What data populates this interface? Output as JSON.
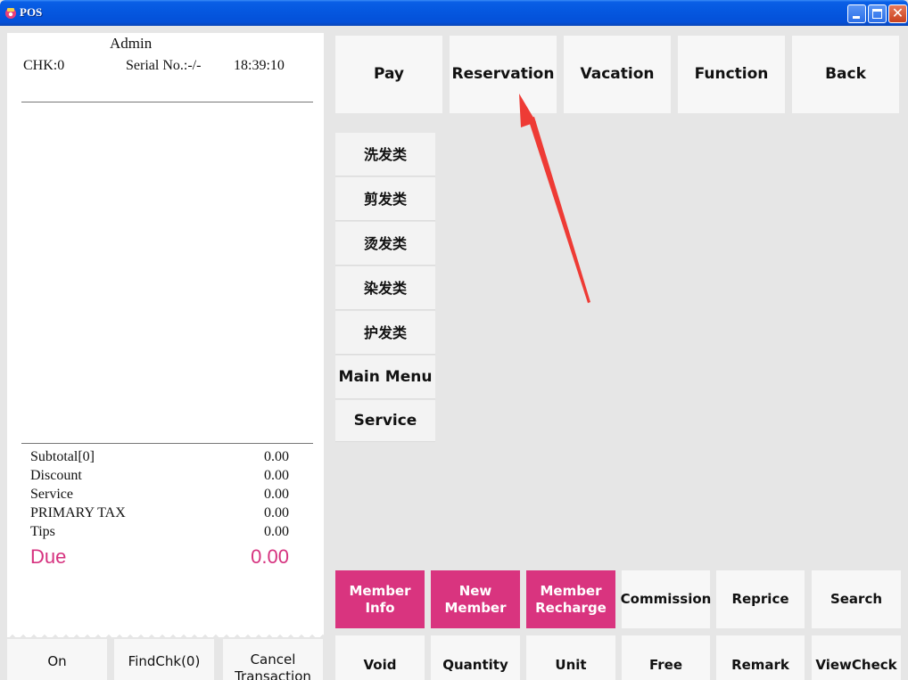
{
  "window": {
    "title": "POS"
  },
  "receipt": {
    "operator": "Admin",
    "check": "CHK:0",
    "serial": "Serial No.:-/-",
    "time": "18:39:10",
    "totals": [
      {
        "label": "Subtotal[0]",
        "value": "0.00"
      },
      {
        "label": "Discount",
        "value": "0.00"
      },
      {
        "label": "Service",
        "value": "0.00"
      },
      {
        "label": "PRIMARY TAX",
        "value": "0.00"
      },
      {
        "label": "Tips",
        "value": "0.00"
      }
    ],
    "due": {
      "label": "Due",
      "value": "0.00"
    }
  },
  "left_actions": {
    "on": "On",
    "find_check": "FindChk(0)",
    "cancel_transaction": "Cancel Transaction"
  },
  "top_actions": {
    "pay": "Pay",
    "reservation": "Reservation",
    "vacation": "Vacation",
    "function": "Function",
    "back": "Back"
  },
  "categories": [
    "洗发类",
    "剪发类",
    "烫发类",
    "染发类",
    "护发类",
    "Main Menu",
    "Service"
  ],
  "member_row": {
    "member_info": "Member Info",
    "new_member": "New Member",
    "member_recharge": "Member Recharge",
    "commission": "Commission",
    "reprice": "Reprice",
    "search": "Search"
  },
  "bottom_row": {
    "void": "Void",
    "quantity": "Quantity",
    "unit": "Unit",
    "free": "Free",
    "remark": "Remark",
    "view_check": "ViewCheck"
  },
  "colors": {
    "accent_pink": "#d9347f",
    "due_text": "#d6327f",
    "annotation_arrow": "#ee3b35",
    "titlebar_blue": "#0558e0"
  }
}
